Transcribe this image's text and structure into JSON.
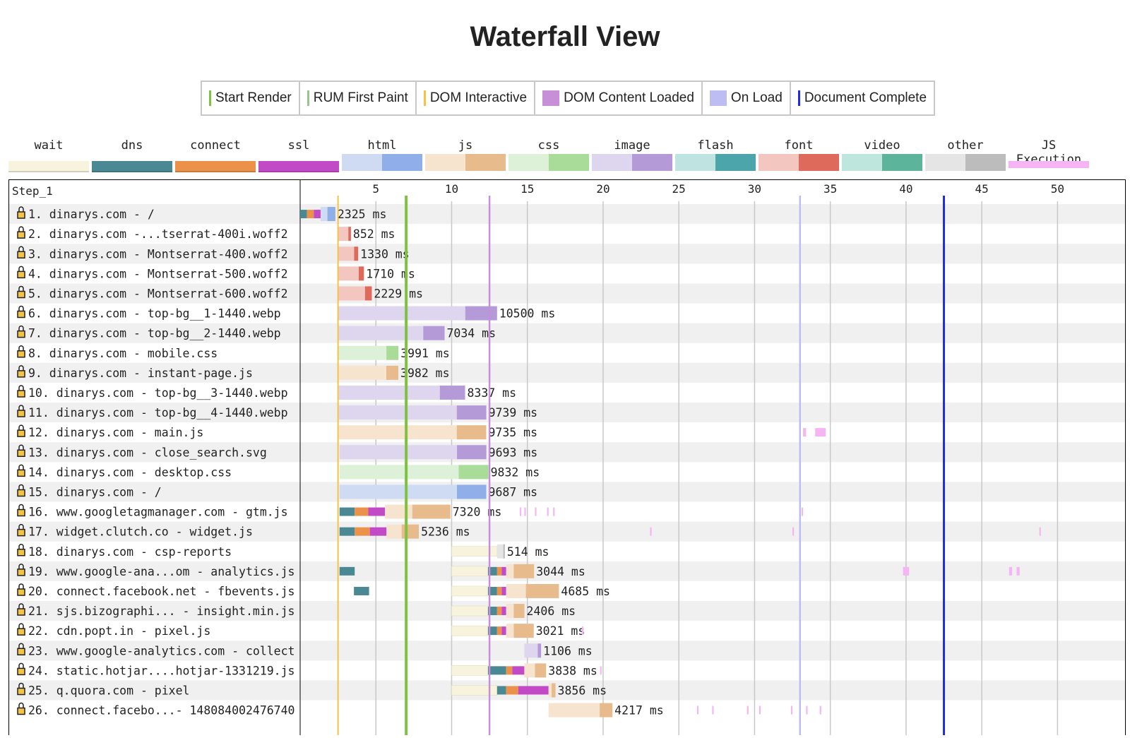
{
  "title": "Waterfall View",
  "legend": [
    {
      "label": "Start Render",
      "color": "#7fc241",
      "kind": "line"
    },
    {
      "label": "RUM First Paint",
      "color": "#97c58a",
      "kind": "line"
    },
    {
      "label": "DOM Interactive",
      "color": "#f4c245",
      "kind": "line"
    },
    {
      "label": "DOM Content Loaded",
      "color": "#c78fd8",
      "kind": "square"
    },
    {
      "label": "On Load",
      "color": "#bdbdf3",
      "kind": "square"
    },
    {
      "label": "Document Complete",
      "color": "#1f2be8",
      "kind": "line"
    }
  ],
  "request_types": [
    {
      "label": "wait",
      "light": "#f7f3dd",
      "dark": "#f7f3dd"
    },
    {
      "label": "dns",
      "light": "#4a8993",
      "dark": "#4a8993"
    },
    {
      "label": "connect",
      "light": "#ec914a",
      "dark": "#ec914a"
    },
    {
      "label": "ssl",
      "light": "#c34ac6",
      "dark": "#c34ac6"
    },
    {
      "label": "html",
      "light": "#cfdbf3",
      "dark": "#90aee8"
    },
    {
      "label": "js",
      "light": "#f7e4cf",
      "dark": "#e8bb8d"
    },
    {
      "label": "css",
      "light": "#ddf0d8",
      "dark": "#a9dc98"
    },
    {
      "label": "image",
      "light": "#ddd6ee",
      "dark": "#b49bd8"
    },
    {
      "label": "flash",
      "light": "#bfe3e1",
      "dark": "#4ca5ab"
    },
    {
      "label": "font",
      "light": "#f3c6c0",
      "dark": "#de6a5c"
    },
    {
      "label": "video",
      "light": "#bfe6dc",
      "dark": "#5cb59b"
    },
    {
      "label": "other",
      "light": "#e5e5e5",
      "dark": "#bcbcbc"
    },
    {
      "label": "JS Execution",
      "light": "#f5b4f3",
      "dark": "#f5b4f3"
    }
  ],
  "chart_data": {
    "type": "waterfall",
    "step_label": "Step_1",
    "x_unit": "seconds",
    "xlim": [
      0,
      52.5
    ],
    "xticks": [
      5,
      10,
      15,
      20,
      25,
      30,
      35,
      40,
      45,
      50
    ],
    "markers": {
      "dom_interactive": 2.5,
      "start_render": 7.0,
      "rum_first_paint": 7.0,
      "dom_content_loaded": 12.5,
      "on_load": 33.0,
      "document_complete": 42.5
    },
    "requests": [
      {
        "label": " 1. dinarys.com - /",
        "type": "html",
        "start": 0.0,
        "ms": 2325,
        "dns": 0.45,
        "connect": 0.45,
        "ssl": 0.45,
        "ttfb": 0.45
      },
      {
        "label": " 2. dinarys.com -...tserrat-400i.woff2",
        "type": "font",
        "start": 2.5,
        "ms": 852
      },
      {
        "label": " 3. dinarys.com - Montserrat-400.woff2",
        "type": "font",
        "start": 2.5,
        "ms": 1330
      },
      {
        "label": " 4. dinarys.com - Montserrat-500.woff2",
        "type": "font",
        "start": 2.5,
        "ms": 1710
      },
      {
        "label": " 5. dinarys.com - Montserrat-600.woff2",
        "type": "font",
        "start": 2.5,
        "ms": 2229
      },
      {
        "label": " 6. dinarys.com - top-bg__1-1440.webp",
        "type": "image",
        "start": 2.5,
        "ms": 10500
      },
      {
        "label": " 7. dinarys.com - top-bg__2-1440.webp",
        "type": "image",
        "start": 2.5,
        "ms": 7034
      },
      {
        "label": " 8. dinarys.com - mobile.css",
        "type": "css",
        "start": 2.5,
        "ms": 3991
      },
      {
        "label": " 9. dinarys.com - instant-page.js",
        "type": "js",
        "start": 2.5,
        "ms": 3982
      },
      {
        "label": "10. dinarys.com - top-bg__3-1440.webp",
        "type": "image",
        "start": 2.55,
        "ms": 8337
      },
      {
        "label": "11. dinarys.com - top-bg__4-1440.webp",
        "type": "image",
        "start": 2.55,
        "ms": 9739
      },
      {
        "label": "12. dinarys.com - main.js",
        "type": "js",
        "start": 2.55,
        "ms": 9735
      },
      {
        "label": "13. dinarys.com - close_search.svg",
        "type": "image",
        "start": 2.6,
        "ms": 9693
      },
      {
        "label": "14. dinarys.com - desktop.css",
        "type": "css",
        "start": 2.6,
        "ms": 9832
      },
      {
        "label": "15. dinarys.com - /",
        "type": "html",
        "start": 2.6,
        "ms": 9687
      },
      {
        "label": "16. www.googletagmanager.com - gtm.js",
        "type": "js",
        "start": 2.6,
        "ms": 7320,
        "dns": 1.0,
        "connect": 0.9,
        "ssl": 1.1,
        "ttfb": 1.8
      },
      {
        "label": "17. widget.clutch.co - widget.js",
        "type": "js",
        "start": 2.6,
        "ms": 5236,
        "dns": 1.0,
        "connect": 1.0,
        "ssl": 1.1,
        "ttfb": 1.0
      },
      {
        "label": "18. dinarys.com - csp-reports",
        "type": "other",
        "start": 10.0,
        "ms": 514,
        "wait": 3.0
      },
      {
        "label": "19. www.google-ana...om - analytics.js",
        "type": "js",
        "start": 10.0,
        "ms": 3044,
        "wait": 2.4,
        "dns": 0.6,
        "connect": 0.3,
        "ssl": 0.3,
        "ttfb": 0.5
      },
      {
        "label": "20. connect.facebook.net - fbevents.js",
        "type": "js",
        "start": 10.0,
        "ms": 4685,
        "wait": 2.4,
        "dns": 0.6,
        "connect": 0.3,
        "ssl": 0.3,
        "ttfb": 1.3
      },
      {
        "label": "21. sjs.bizographi... - insight.min.js",
        "type": "js",
        "start": 10.0,
        "ms": 2406,
        "wait": 2.4,
        "dns": 0.6,
        "connect": 0.3,
        "ssl": 0.3,
        "ttfb": 0.5
      },
      {
        "label": "22. cdn.popt.in - pixel.js",
        "type": "js",
        "start": 10.0,
        "ms": 3021,
        "wait": 2.4,
        "dns": 0.6,
        "connect": 0.3,
        "ssl": 0.3,
        "ttfb": 0.5
      },
      {
        "label": "23. www.google-analytics.com - collect",
        "type": "image",
        "start": 14.8,
        "ms": 1106
      },
      {
        "label": "24. static.hotjar....hotjar-1331219.js",
        "type": "js",
        "start": 10.0,
        "ms": 3838,
        "wait": 2.4,
        "dns": 1.2,
        "connect": 0.4,
        "ssl": 0.8,
        "ttfb": 0.7
      },
      {
        "label": "25. q.quora.com - pixel",
        "type": "js",
        "start": 10.0,
        "ms": 3856,
        "wait": 3.0,
        "dns": 0.6,
        "connect": 0.8,
        "ssl": 2.0,
        "ttfb": 0.2
      },
      {
        "label": "26. connect.facebo...- 148084002476740",
        "type": "js",
        "start": 16.4,
        "ms": 4217
      }
    ],
    "js_execution": [
      {
        "row": 12,
        "ranges": [
          [
            33.2,
            33.4
          ],
          [
            34.0,
            34.7
          ]
        ]
      },
      {
        "row": 16,
        "ranges": [
          [
            14.5,
            14.6
          ],
          [
            14.8,
            14.9
          ],
          [
            15.5,
            15.6
          ],
          [
            16.3,
            16.4
          ],
          [
            16.7,
            16.8
          ],
          [
            33.1,
            33.2
          ]
        ]
      },
      {
        "row": 17,
        "ranges": [
          [
            23.1,
            23.2
          ],
          [
            32.5,
            32.6
          ],
          [
            48.8,
            48.9
          ]
        ]
      },
      {
        "row": 19,
        "ranges": [
          [
            39.8,
            40.2
          ],
          [
            46.8,
            47.0
          ],
          [
            47.3,
            47.5
          ]
        ]
      },
      {
        "row": 22,
        "ranges": [
          [
            18.6,
            18.7
          ]
        ]
      },
      {
        "row": 24,
        "ranges": [
          [
            19.8,
            19.9
          ]
        ]
      },
      {
        "row": 26,
        "ranges": [
          [
            26.2,
            26.3
          ],
          [
            27.2,
            27.3
          ],
          [
            29.5,
            29.6
          ],
          [
            30.3,
            30.4
          ],
          [
            32.4,
            32.5
          ],
          [
            33.4,
            33.5
          ],
          [
            34.3,
            34.4
          ]
        ]
      }
    ],
    "extra_dns": [
      {
        "row": 19,
        "start": 2.6,
        "end": 3.6
      },
      {
        "row": 20,
        "start": 3.55,
        "end": 4.55
      }
    ]
  }
}
